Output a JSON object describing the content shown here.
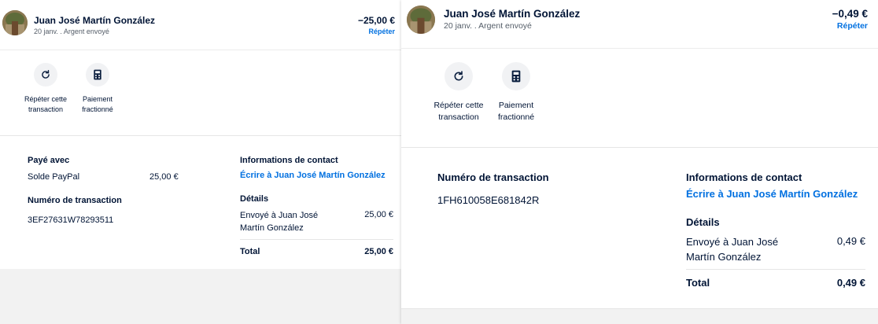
{
  "left": {
    "header": {
      "name": "Juan José Martín González",
      "subtitle": "20 janv. . Argent envoyé",
      "amount": "−25,00 €",
      "repeat": "Répéter"
    },
    "actions": {
      "repeat_label": "Répéter cette transaction",
      "split_label": "Paiement fractionné"
    },
    "paid_with": {
      "title": "Payé avec",
      "method": "Solde PayPal",
      "amount": "25,00 €"
    },
    "transaction": {
      "title": "Numéro de transaction",
      "id": "3EF27631W78293511"
    },
    "contact": {
      "title": "Informations de contact",
      "link": "Écrire à Juan José Martín González"
    },
    "details": {
      "title": "Détails",
      "sent_label": "Envoyé à Juan José Martín González",
      "sent_amount": "25,00 €",
      "total_label": "Total",
      "total_amount": "25,00 €"
    }
  },
  "right": {
    "header": {
      "name": "Juan José Martín González",
      "subtitle": "20 janv. . Argent envoyé",
      "amount": "−0,49 €",
      "repeat": "Répéter"
    },
    "actions": {
      "repeat_label": "Répéter cette transaction",
      "split_label": "Paiement fractionné"
    },
    "transaction": {
      "title": "Numéro de transaction",
      "id": "1FH610058E681842R"
    },
    "contact": {
      "title": "Informations de contact",
      "link": "Écrire à Juan José Martín González"
    },
    "details": {
      "title": "Détails",
      "sent_label": "Envoyé à Juan José Martín González",
      "sent_amount": "0,49 €",
      "total_label": "Total",
      "total_amount": "0,49 €"
    }
  },
  "icons": {
    "repeat": "refresh-icon",
    "split": "calculator-icon",
    "avatar": "avatar-photo"
  },
  "colors": {
    "link": "#0070e0",
    "text": "#001435",
    "muted": "#545d68",
    "icon_bg": "#f1f2f4",
    "page_bg": "#f2f2f2"
  }
}
